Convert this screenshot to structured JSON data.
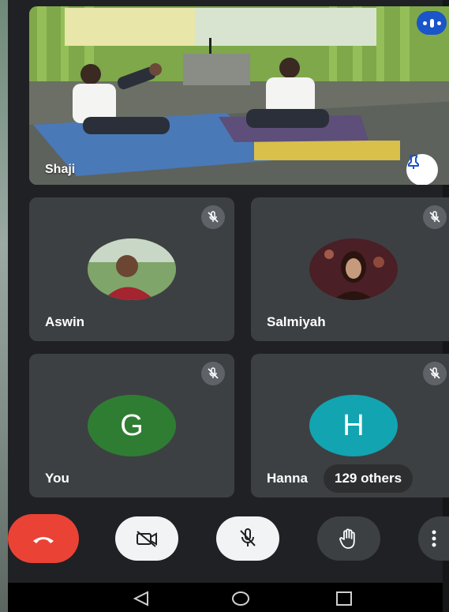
{
  "main_video": {
    "speaker_name": "Shaji",
    "pin_icon": "pin-icon",
    "more_icon": "more-options-icon"
  },
  "participants": [
    {
      "name": "Aswin",
      "avatar_type": "photo",
      "mic": "muted",
      "avatar_color": "#6a8a5a"
    },
    {
      "name": "Salmiyah",
      "avatar_type": "photo",
      "mic": "muted",
      "avatar_color": "#5a2a30"
    },
    {
      "name": "You",
      "avatar_type": "initial",
      "initial": "G",
      "mic": "muted",
      "avatar_color": "#2f7d32"
    },
    {
      "name": "Hanna",
      "avatar_type": "initial",
      "initial": "H",
      "mic": "muted",
      "avatar_color": "#12a4b1"
    }
  ],
  "others_count_label": "129 others",
  "controls": {
    "end_call": "end-call-icon",
    "camera": "camera-off-icon",
    "microphone": "mic-off-icon",
    "raise_hand": "raise-hand-icon",
    "more": "more-vert-icon"
  },
  "colors": {
    "background": "#202124",
    "tile": "#3c4043",
    "end_call": "#ea4335",
    "accent_blue": "#1a55c9"
  },
  "nav": {
    "back": "back-triangle-icon",
    "home": "home-circle-icon",
    "recents": "recents-square-icon"
  }
}
